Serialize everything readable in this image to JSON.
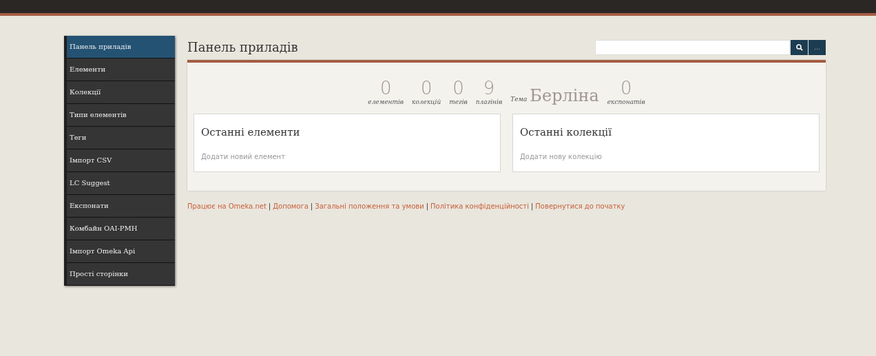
{
  "sidebar": {
    "items": [
      {
        "label": "Панель приладів",
        "selected": true
      },
      {
        "label": "Елементи",
        "selected": false
      },
      {
        "label": "Колекції",
        "selected": false
      },
      {
        "label": "Типи елементів",
        "selected": false
      },
      {
        "label": "Теги",
        "selected": false
      },
      {
        "label": "Імпорт CSV",
        "selected": false
      },
      {
        "label": "LC Suggest",
        "selected": false
      },
      {
        "label": "Експонати",
        "selected": false
      },
      {
        "label": "Комбайн OAI-PMH",
        "selected": false
      },
      {
        "label": "Імпорт Omeka Api",
        "selected": false
      },
      {
        "label": "Прості сторінки",
        "selected": false
      }
    ]
  },
  "page_title": "Панель приладів",
  "search": {
    "more_label": "..."
  },
  "stats": [
    {
      "kind": "count",
      "value": "0",
      "label": "елементів"
    },
    {
      "kind": "count",
      "value": "0",
      "label": "колекцій"
    },
    {
      "kind": "count",
      "value": "0",
      "label": "тегів"
    },
    {
      "kind": "count",
      "value": "9",
      "label": "плагінів"
    },
    {
      "kind": "theme",
      "value": "Берліна",
      "label": "Тема"
    },
    {
      "kind": "count",
      "value": "0",
      "label": "експонатів"
    }
  ],
  "cards": [
    {
      "title": "Останні елементи",
      "link": "Додати новий елемент"
    },
    {
      "title": "Останні колекції",
      "link": "Додати нову колекцію"
    }
  ],
  "footer": {
    "separator": "|",
    "links": [
      "Працює на Omeka.net",
      "Допомога",
      "Загальні положення та умови",
      "Політика конфіденційності",
      "Повернутися до початку"
    ]
  }
}
